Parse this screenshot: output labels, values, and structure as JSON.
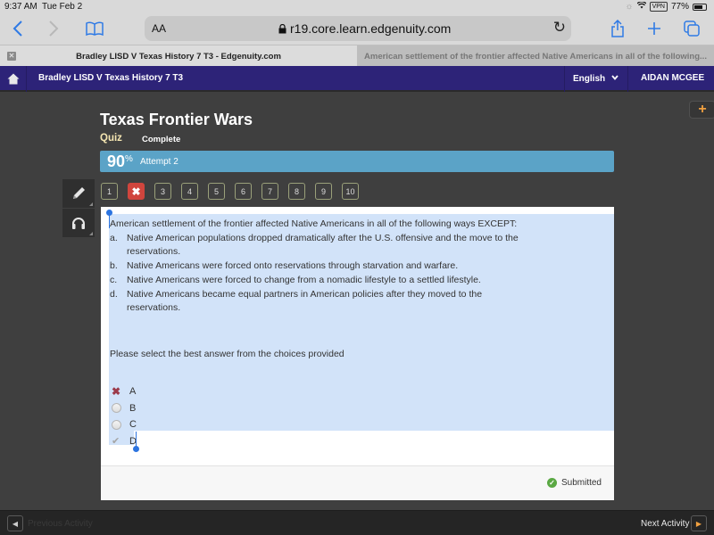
{
  "status_bar": {
    "time": "9:37 AM",
    "date": "Tue Feb 2",
    "vpn": "VPN",
    "battery": "77%",
    "battery_level": 0.77
  },
  "browser": {
    "text_size_label": "AA",
    "url": "r19.core.learn.edgenuity.com",
    "tabs": [
      {
        "title": "Bradley LISD V Texas History 7 T3 - Edgenuity.com",
        "active": true
      },
      {
        "title": "American settlement of the frontier affected Native Americans in all of the following...",
        "active": false
      }
    ]
  },
  "header": {
    "course_title": "Bradley LISD V Texas History 7 T3",
    "language": "English",
    "user_name": "AIDAN MCGEE"
  },
  "activity": {
    "title": "Texas Frontier Wars",
    "type": "Quiz",
    "status": "Complete",
    "score": "90",
    "score_unit": "%",
    "attempt": "Attempt 2"
  },
  "question_nav": [
    {
      "label": "1",
      "state": "normal"
    },
    {
      "label": "✖",
      "state": "wrong"
    },
    {
      "label": "3",
      "state": "normal"
    },
    {
      "label": "4",
      "state": "normal"
    },
    {
      "label": "5",
      "state": "normal"
    },
    {
      "label": "6",
      "state": "normal"
    },
    {
      "label": "7",
      "state": "normal"
    },
    {
      "label": "8",
      "state": "normal"
    },
    {
      "label": "9",
      "state": "normal"
    },
    {
      "label": "10",
      "state": "normal"
    }
  ],
  "question": {
    "stem": "American settlement of the frontier affected Native Americans in all of the following ways EXCEPT:",
    "options": [
      {
        "letter": "a.",
        "text": "Native American populations dropped dramatically after the U.S. offensive and the move to the reservations."
      },
      {
        "letter": "b.",
        "text": "Native Americans were forced onto reservations through starvation and warfare."
      },
      {
        "letter": "c.",
        "text": "Native Americans were forced to change from a nomadic lifestyle to a settled lifestyle."
      },
      {
        "letter": "d.",
        "text": "Native Americans became equal partners in American policies after they moved to the reservations."
      }
    ],
    "prompt": "Please select the best answer from the choices provided",
    "answers": [
      {
        "label": "A",
        "state": "incorrect-selected"
      },
      {
        "label": "B",
        "state": "unselected"
      },
      {
        "label": "C",
        "state": "unselected"
      },
      {
        "label": "D",
        "state": "correct"
      }
    ],
    "submission_status": "Submitted"
  },
  "footer": {
    "previous_label": "Previous Activity",
    "next_label": "Next Activity"
  }
}
